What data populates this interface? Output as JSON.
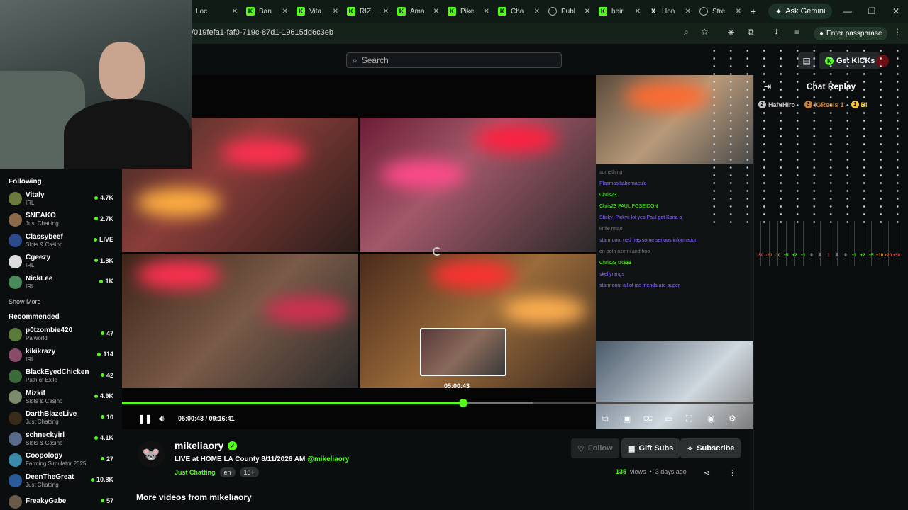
{
  "browser": {
    "tabs": [
      {
        "title": "Loc",
        "icon": "web"
      },
      {
        "title": "Ban",
        "icon": "kick"
      },
      {
        "title": "Vita",
        "icon": "kick"
      },
      {
        "title": "RIZL",
        "icon": "kick"
      },
      {
        "title": "Ama",
        "icon": "kick"
      },
      {
        "title": "Pike",
        "icon": "kick"
      },
      {
        "title": "Cha",
        "icon": "kick"
      },
      {
        "title": "Publ",
        "icon": "globe"
      },
      {
        "title": "heir",
        "icon": "kick"
      },
      {
        "title": "Hon",
        "icon": "x"
      },
      {
        "title": "Stre",
        "icon": "globe"
      }
    ],
    "new_tab": "+",
    "gemini_label": "Ask Gemini",
    "url": "/019fefa1-faf0-719c-87d1-19615dd6c3eb",
    "passphrase_label": "Enter passphrase"
  },
  "header": {
    "search_placeholder": "Search",
    "get_kicks_label": "Get KICKs"
  },
  "sidebar": {
    "following_title": "Following",
    "following": [
      {
        "name": "Vitaly",
        "category": "IRL",
        "viewers": "4.7K",
        "color": "#6a7a3a"
      },
      {
        "name": "SNEAKO",
        "category": "Just Chatting",
        "viewers": "2.7K",
        "color": "#8a6a4a"
      },
      {
        "name": "Classybeef",
        "category": "Slots & Casino",
        "viewers": "LIVE",
        "color": "#2a4a8a"
      },
      {
        "name": "Cgeezy",
        "category": "IRL",
        "viewers": "1.8K",
        "color": "#dddddd"
      },
      {
        "name": "NickLee",
        "category": "IRL",
        "viewers": "1K",
        "color": "#4a8a5a"
      }
    ],
    "show_more": "Show More",
    "recommended_title": "Recommended",
    "recommended": [
      {
        "name": "p0tzombie420",
        "category": "Palworld",
        "viewers": "47",
        "color": "#5a7a3a"
      },
      {
        "name": "kikikrazy",
        "category": "IRL",
        "viewers": "114",
        "color": "#8a4a6a"
      },
      {
        "name": "BlackEyedChicken",
        "category": "Path of Exile",
        "viewers": "42",
        "color": "#3a6a3a"
      },
      {
        "name": "Mizkif",
        "category": "Slots & Casino",
        "viewers": "4.9K",
        "color": "#7a8a6a"
      },
      {
        "name": "DarthBlazeLive",
        "category": "Just Chatting",
        "viewers": "10",
        "color": "#3a2a1a"
      },
      {
        "name": "schneckyirl",
        "category": "Slots & Casino",
        "viewers": "4.1K",
        "color": "#5a6a8a"
      },
      {
        "name": "Coopology",
        "category": "Farming Simulator 2025",
        "viewers": "27",
        "color": "#3a8aaa"
      },
      {
        "name": "DeenTheGreat",
        "category": "Just Chatting",
        "viewers": "10.8K",
        "color": "#2a5a9a"
      },
      {
        "name": "FreakyGabe",
        "category": "",
        "viewers": "57",
        "color": "#6a5a4a"
      }
    ]
  },
  "video": {
    "preview_time": "05:00:43",
    "current_time": "05:00:43",
    "total_time": "09:16:41",
    "progress_fraction": 0.541,
    "buffered_fraction": 0.65,
    "overlay_chat": [
      "something",
      "Plasmasiltabernaculo",
      "Chris23",
      "Chris23 PAUL POSEIDON",
      "Sticky_Pickyi: lol yes Paul got Kana a",
      "knife rmao",
      "",
      "starmoon: ned has some serious information",
      "on both ozemi and hoo",
      "Chris23 uk$$$",
      "skellyrangs",
      "starmoon: all of ice friends are super"
    ]
  },
  "chat": {
    "title": "Chat Replay",
    "gifters": [
      {
        "rank": "2",
        "name": "HafuHiro",
        "count": "",
        "color": "#c0c0c0"
      },
      {
        "rank": "3",
        "name": "IGReels",
        "count": "1",
        "color": "#cd7f32"
      },
      {
        "rank": "1",
        "name": "Bl",
        "count": "",
        "color": "#f5c542"
      }
    ],
    "eq_values": [
      "-50",
      "-20",
      "-10",
      "+5",
      "+2",
      "+1",
      "0",
      "0",
      "1",
      "0",
      "0",
      "+1",
      "+2",
      "+5",
      "+10",
      "+20",
      "+50"
    ],
    "eq_colors": [
      "#e04040",
      "#e06030",
      "#e0a030",
      "#53fc18",
      "#53fc18",
      "#53fc18",
      "#cccccc",
      "#cccccc",
      "#e04040",
      "#cccccc",
      "#cccccc",
      "#53fc18",
      "#53fc18",
      "#53fc18",
      "#e0a030",
      "#e06030",
      "#e04040"
    ]
  },
  "channel": {
    "name": "mikeliaory",
    "stream_title": "LIVE at HOME LA County 8/11/2026 AM",
    "handle": "@mikeliaory",
    "category": "Just Chatting",
    "tags": [
      "en",
      "18+"
    ],
    "follow_label": "Follow",
    "gift_label": "Gift Subs",
    "subscribe_label": "Subscribe",
    "views": "135",
    "views_label": "views",
    "age": "3 days ago",
    "more_videos": "More videos from mikeliaory"
  },
  "colors": {
    "accent": "#53fc18",
    "bg": "#0b0e0f"
  }
}
